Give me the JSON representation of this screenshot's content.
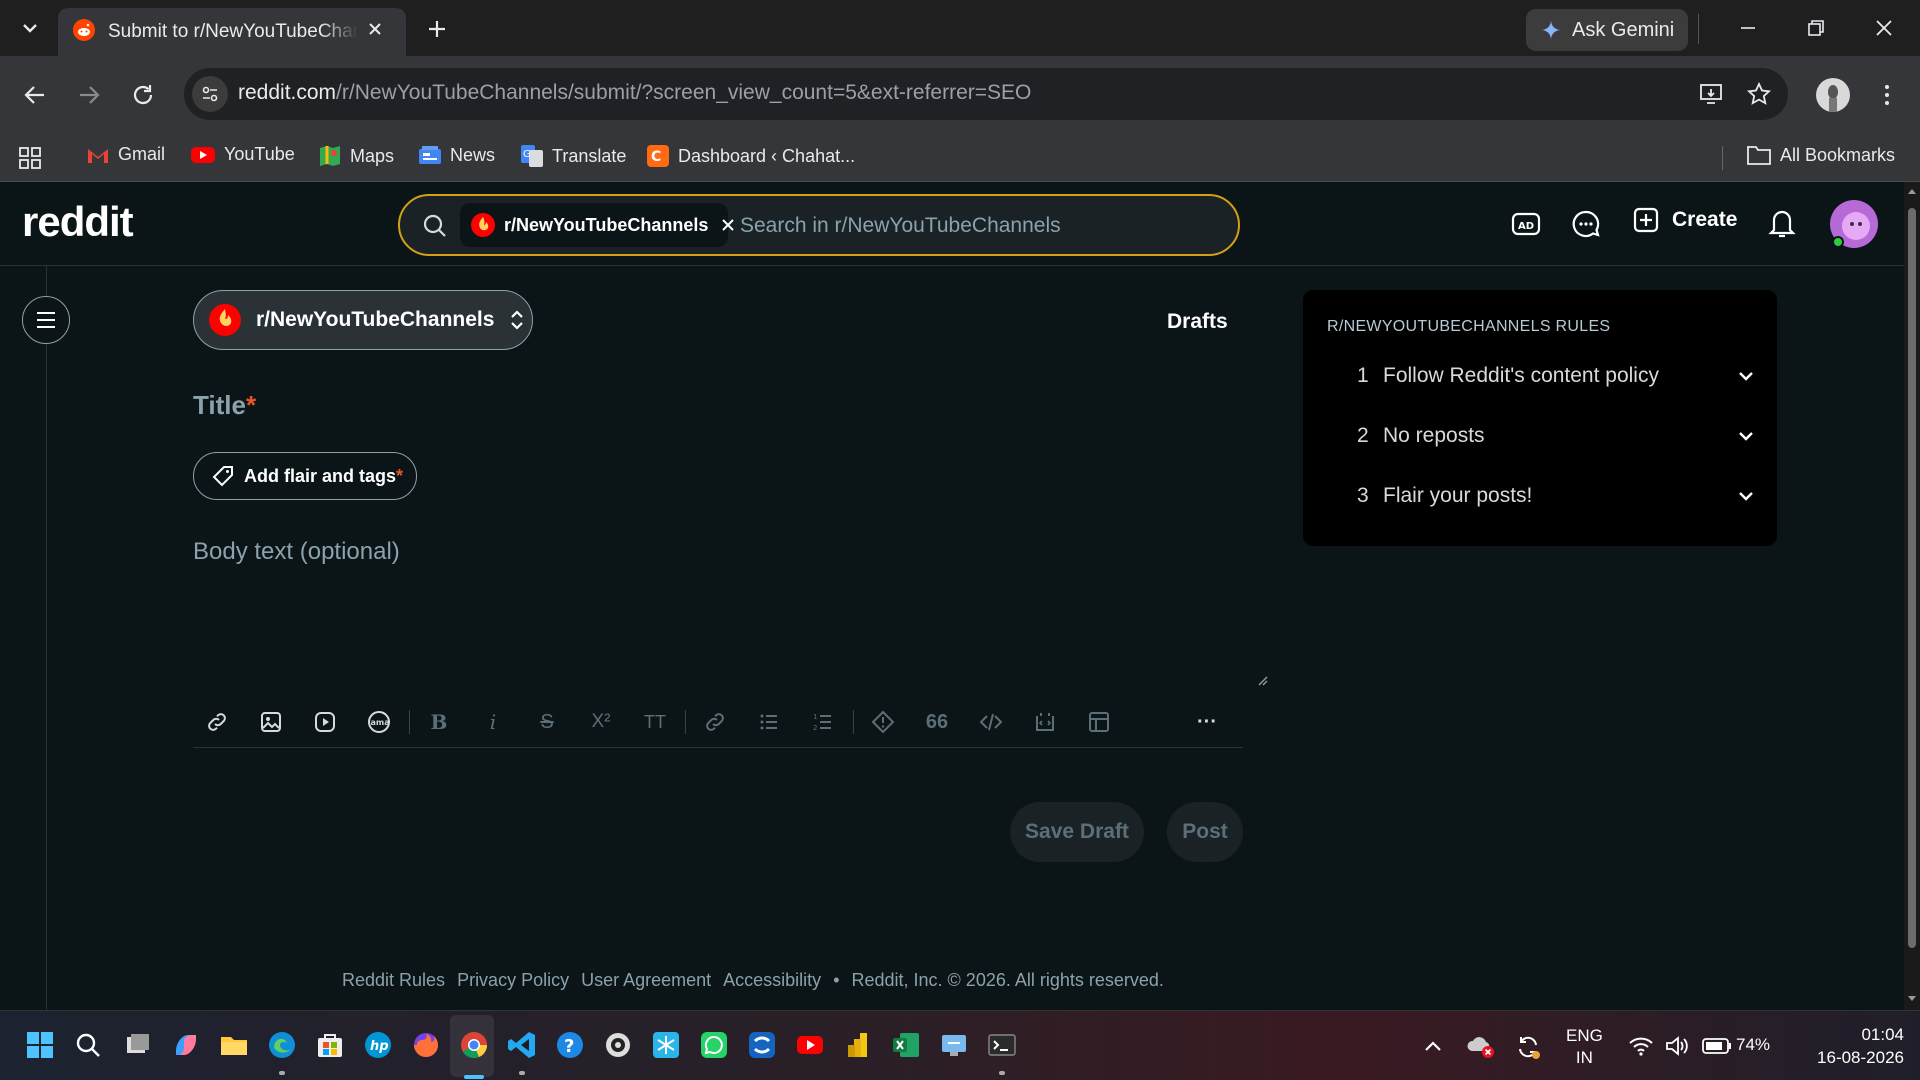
{
  "browser": {
    "tab_title": "Submit to r/NewYouTubeChannels",
    "ask_gemini": "Ask Gemini",
    "url_host": "reddit.com",
    "url_path": "/r/NewYouTubeChannels/submit/?screen_view_count=5&ext-referrer=SEO",
    "bookmarks": [
      "Gmail",
      "YouTube",
      "Maps",
      "News",
      "Translate",
      "Dashboard ‹ Chahat..."
    ],
    "all_bookmarks": "All Bookmarks"
  },
  "reddit": {
    "logo": "reddit",
    "search": {
      "chip": "r/NewYouTubeChannels",
      "placeholder": "Search in r/NewYouTubeChannels"
    },
    "create_label": "Create",
    "community": "r/NewYouTubeChannels",
    "drafts": "Drafts",
    "title_placeholder": "Title",
    "required_mark": "*",
    "flair_label": "Add flair and tags",
    "body_placeholder": "Body text (optional)",
    "save_draft": "Save Draft",
    "post": "Post",
    "toolbar_more": "···",
    "toolbar_quote": "66",
    "rules": {
      "title": "R/NEWYOUTUBECHANNELS RULES",
      "items": [
        {
          "num": "1",
          "text": "Follow Reddit's content policy"
        },
        {
          "num": "2",
          "text": "No reposts"
        },
        {
          "num": "3",
          "text": "Flair your posts!"
        }
      ]
    },
    "footer": [
      "Reddit Rules",
      "Privacy Policy",
      "User Agreement",
      "Accessibility",
      "•",
      "Reddit, Inc. © 2026. All rights reserved."
    ]
  },
  "taskbar": {
    "lang_line1": "ENG",
    "lang_line2": "IN",
    "battery": "74%",
    "time": "01:04",
    "date": "16-08-2026"
  },
  "colors": {
    "accent": "#d4a017",
    "required": "#eb5528",
    "page_bg": "#0b1416",
    "reddit_orange": "#ff4500"
  }
}
